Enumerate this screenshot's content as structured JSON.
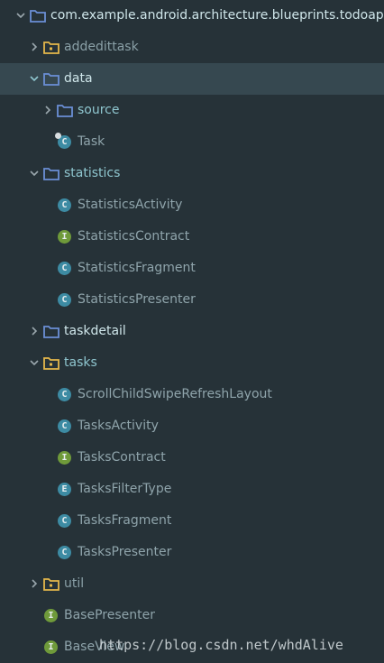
{
  "tree": {
    "root": "com.example.android.architecture.blueprints.todoapp",
    "addedittask": "addedittask",
    "data": "data",
    "source": "source",
    "task": "Task",
    "statistics": "statistics",
    "statistics_activity": "StatisticsActivity",
    "statistics_contract": "StatisticsContract",
    "statistics_fragment": "StatisticsFragment",
    "statistics_presenter": "StatisticsPresenter",
    "taskdetail": "taskdetail",
    "tasks": "tasks",
    "scroll_child": "ScrollChildSwipeRefreshLayout",
    "tasks_activity": "TasksActivity",
    "tasks_contract": "TasksContract",
    "tasks_filter_type": "TasksFilterType",
    "tasks_fragment": "TasksFragment",
    "tasks_presenter": "TasksPresenter",
    "util": "util",
    "base_presenter": "BasePresenter",
    "base_view": "BaseView"
  },
  "badges": {
    "class": "C",
    "interface": "I",
    "enum": "E"
  },
  "watermark": "https://blog.csdn.net/whdAlive",
  "colors": {
    "background": "#263238",
    "selected_row": "#364850",
    "folder_blue": "#6b8fd6",
    "folder_yellow": "#e5b84b",
    "class_badge": "#3d8ba3",
    "interface_badge": "#6f9a3a"
  }
}
